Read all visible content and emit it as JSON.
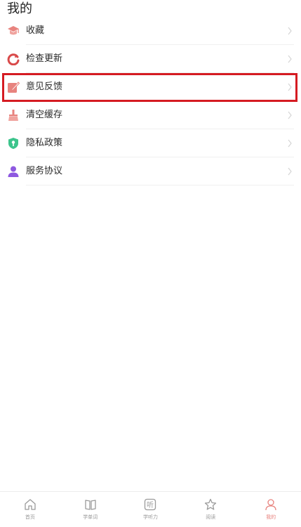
{
  "header": {
    "title": "我的"
  },
  "menu": [
    {
      "label": "收藏",
      "icon": "graduation-cap-icon"
    },
    {
      "label": "检查更新",
      "icon": "refresh-icon"
    },
    {
      "label": "意见反馈",
      "icon": "edit-note-icon"
    },
    {
      "label": "清空缓存",
      "icon": "broom-icon"
    },
    {
      "label": "隐私政策",
      "icon": "privacy-shield-icon"
    },
    {
      "label": "服务协议",
      "icon": "user-icon"
    }
  ],
  "tabs": [
    {
      "label": "首页",
      "icon": "home-icon"
    },
    {
      "label": "学单词",
      "icon": "book-icon"
    },
    {
      "label": "学听力",
      "icon": "listen-icon",
      "glyph": "听"
    },
    {
      "label": "阅读",
      "icon": "star-icon"
    },
    {
      "label": "我的",
      "icon": "profile-icon",
      "active": true
    }
  ],
  "colors": {
    "accent": "#e8837e",
    "highlight_border": "#d51b22",
    "privacy_icon": "#3cc48c",
    "user_icon": "#8e59e0"
  }
}
